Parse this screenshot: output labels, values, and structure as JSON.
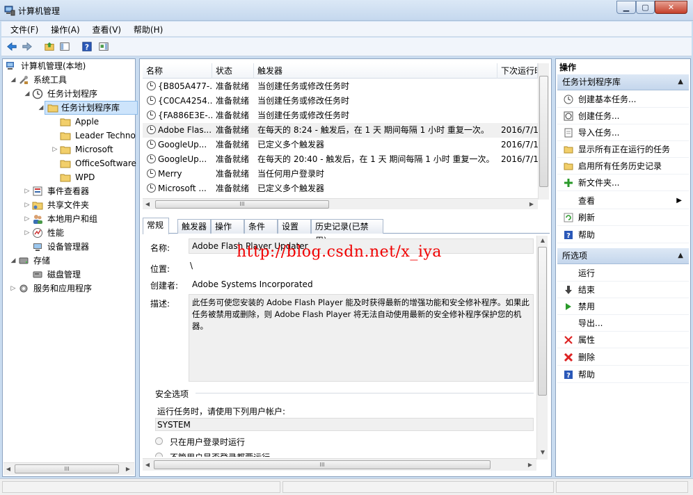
{
  "window": {
    "title": "计算机管理"
  },
  "menu": [
    "文件(F)",
    "操作(A)",
    "查看(V)",
    "帮助(H)"
  ],
  "tree": [
    {
      "label": "计算机管理(本地)",
      "icon": "computer-icon"
    },
    {
      "label": "系统工具",
      "icon": "tools-icon"
    },
    {
      "label": "任务计划程序",
      "icon": "clock-icon"
    },
    {
      "label": "任务计划程序库",
      "icon": "folder-icon"
    },
    {
      "label": "Apple",
      "icon": "folder-icon"
    },
    {
      "label": "Leader Techno",
      "icon": "folder-icon"
    },
    {
      "label": "Microsoft",
      "icon": "folder-icon"
    },
    {
      "label": "OfficeSoftware",
      "icon": "folder-icon"
    },
    {
      "label": "WPD",
      "icon": "folder-icon"
    },
    {
      "label": "事件查看器",
      "icon": "event-viewer-icon"
    },
    {
      "label": "共享文件夹",
      "icon": "shared-folder-icon"
    },
    {
      "label": "本地用户和组",
      "icon": "users-icon"
    },
    {
      "label": "性能",
      "icon": "performance-icon"
    },
    {
      "label": "设备管理器",
      "icon": "device-manager-icon"
    },
    {
      "label": "存储",
      "icon": "storage-icon"
    },
    {
      "label": "磁盘管理",
      "icon": "disk-icon"
    },
    {
      "label": "服务和应用程序",
      "icon": "services-icon"
    }
  ],
  "task_list": {
    "columns": [
      "名称",
      "状态",
      "触发器",
      "下次运行时"
    ],
    "rows": [
      {
        "name": "{B805A477-...",
        "status": "准备就绪",
        "trigger": "当创建任务或修改任务时",
        "next": ""
      },
      {
        "name": "{C0CA4254...",
        "status": "准备就绪",
        "trigger": "当创建任务或修改任务时",
        "next": ""
      },
      {
        "name": "{FA886E3E-...",
        "status": "准备就绪",
        "trigger": "当创建任务或修改任务时",
        "next": ""
      },
      {
        "name": "Adobe Flas...",
        "status": "准备就绪",
        "trigger": "在每天的 8:24 - 触发后，在 1 天 期间每隔 1 小时 重复一次。",
        "next": "2016/7/1"
      },
      {
        "name": "GoogleUp...",
        "status": "准备就绪",
        "trigger": "已定义多个触发器",
        "next": "2016/7/1"
      },
      {
        "name": "GoogleUp...",
        "status": "准备就绪",
        "trigger": "在每天的 20:40 - 触发后，在 1 天 期间每隔 1 小时 重复一次。",
        "next": "2016/7/1"
      },
      {
        "name": "Merry",
        "status": "准备就绪",
        "trigger": "当任何用户登录时",
        "next": ""
      },
      {
        "name": "Microsoft ...",
        "status": "准备就绪",
        "trigger": "已定义多个触发器",
        "next": ""
      }
    ]
  },
  "tabs": [
    "常规",
    "触发器",
    "操作",
    "条件",
    "设置",
    "历史记录(已禁用)"
  ],
  "details": {
    "name_label": "名称:",
    "name_value": "Adobe Flash Player Updater",
    "location_label": "位置:",
    "location_value": "\\",
    "author_label": "创建者:",
    "author_value": "Adobe Systems Incorporated",
    "desc_label": "描述:",
    "desc_value": "此任务可使您安装的 Adobe Flash Player 能及时获得最新的增强功能和安全修补程序。如果此任务被禁用或删除，则 Adobe Flash Player 将无法自动使用最新的安全修补程序保护您的机器。",
    "security_title": "安全选项",
    "run_as_label": "运行任务时，请使用下列用户帐户:",
    "run_as_value": "SYSTEM",
    "option1": "只在用户登录时运行",
    "option2": "不管用户是否登录都要运行"
  },
  "watermark": "http://blog.csdn.net/x_iya",
  "actions": {
    "title": "操作",
    "section1": "任务计划程序库",
    "items1": [
      "创建基本任务...",
      "创建任务...",
      "导入任务...",
      "显示所有正在运行的任务",
      "启用所有任务历史记录",
      "新文件夹...",
      "查看",
      "刷新",
      "帮助"
    ],
    "section2": "所选项",
    "items2": [
      "运行",
      "结束",
      "禁用",
      "导出...",
      "属性",
      "删除",
      "帮助"
    ]
  },
  "scroll_glyph": "III",
  "colors": {
    "selection": "#cde4fb",
    "watermark": "#f00000",
    "header": "#c4d6ec"
  }
}
